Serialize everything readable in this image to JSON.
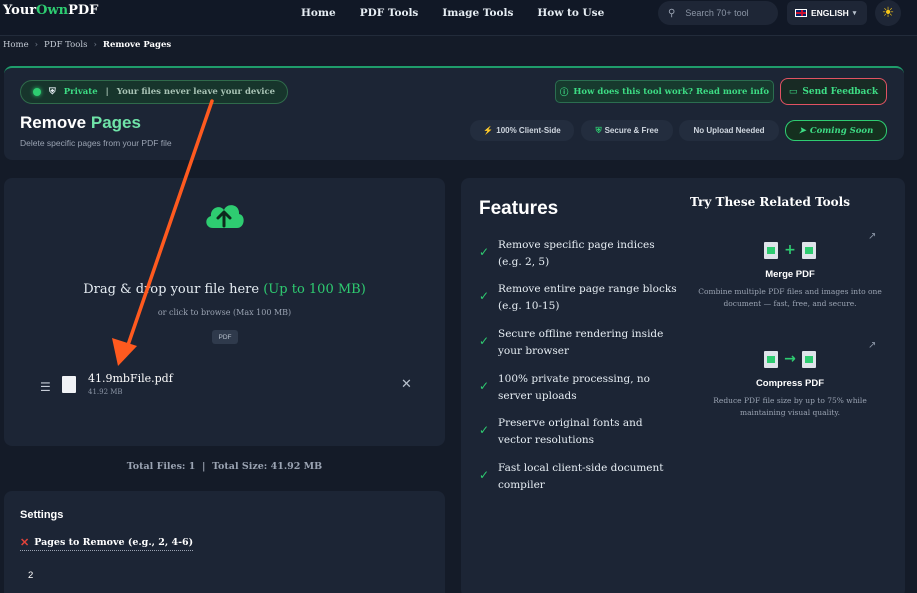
{
  "nav": {
    "logo_prefix": "Your",
    "logo_accent": "Own",
    "logo_suffix": "PDF",
    "links": [
      "Home",
      "PDF Tools",
      "Image Tools",
      "How to Use"
    ],
    "search_placeholder": "Search 70+ tool",
    "language": "ENGLISH"
  },
  "breadcrumb": [
    "Home",
    "PDF Tools",
    "Remove Pages"
  ],
  "hero": {
    "private_label": "Private",
    "private_note": "Your files never leave your device",
    "title_main": "Remove",
    "title_accent": "Pages",
    "subtitle": "Delete specific pages from your PDF file",
    "how_button": "How does this tool work? Read more info",
    "feedback_button": "Send Feedback",
    "badges": [
      "100% Client-Side",
      "Secure & Free",
      "No Upload Needed"
    ],
    "coming_soon": "Coming Soon"
  },
  "upload": {
    "drop_title": "Drag & drop your file here",
    "drop_limit": "(Up to 100 MB)",
    "drop_sub": "or click to browse (Max 100 MB)",
    "format_tag": "PDF",
    "file": {
      "name": "41.9mbFile.pdf",
      "size": "41.92 MB"
    }
  },
  "totals": {
    "files_label": "Total Files:",
    "files_count": "1",
    "size_label": "Total Size:",
    "size_value": "41.92 MB"
  },
  "settings": {
    "title": "Settings",
    "pages_label": "Pages to Remove (e.g., 2, 4-6)",
    "pages_value": "2"
  },
  "features": {
    "title": "Features",
    "items": [
      "Remove specific page indices (e.g. 2, 5)",
      "Remove entire page range blocks (e.g. 10-15)",
      "Secure offline rendering inside your browser",
      "100% private processing, no server uploads",
      "Preserve original fonts and vector resolutions",
      "Fast local client-side document compiler"
    ]
  },
  "related": {
    "title": "Try These Related Tools",
    "tools": [
      {
        "name": "Merge PDF",
        "desc": "Combine multiple PDF files and images into one document — fast, free, and secure."
      },
      {
        "name": "Compress PDF",
        "desc": "Reduce PDF file size by up to 75% while maintaining visual quality."
      }
    ]
  },
  "colors": {
    "accent": "#2ecc71",
    "background": "#141b28",
    "card": "#1c2535",
    "annotation_arrow": "#ff5a1f",
    "feedback_border": "#e05262"
  },
  "icons": [
    "search-icon",
    "shield-icon",
    "info-icon",
    "chat-icon",
    "bolt-icon",
    "lock-icon",
    "rocket-icon",
    "cloud-upload-icon",
    "drag-handle-icon",
    "file-icon",
    "close-icon",
    "check-icon",
    "merge-icon",
    "compress-icon",
    "external-link-icon",
    "sun-icon"
  ]
}
